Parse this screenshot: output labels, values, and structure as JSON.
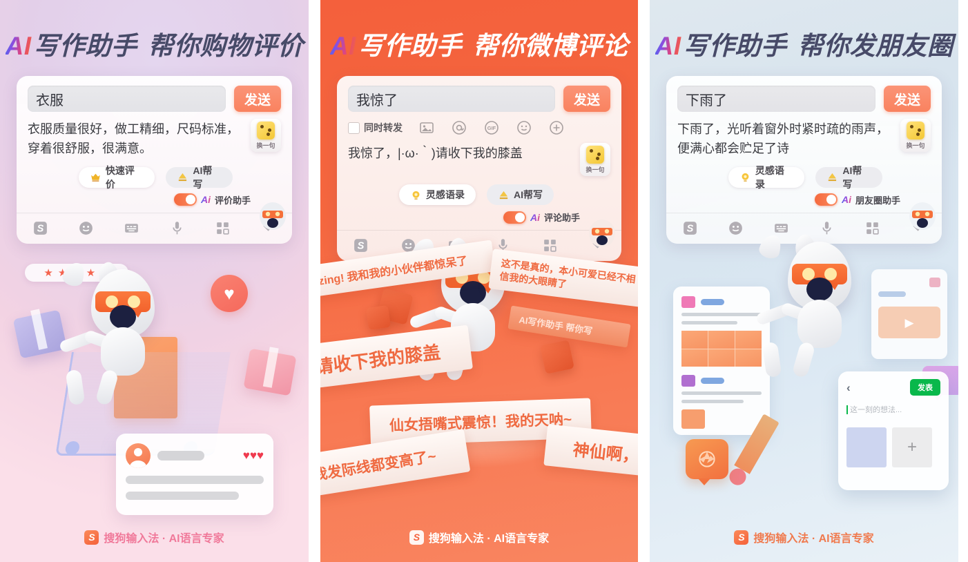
{
  "panels": [
    {
      "id": "shopping-review",
      "headline": {
        "ai": "AI",
        "main": "写作助手",
        "sub": "帮你购物评价"
      },
      "card": {
        "input_value": "衣服",
        "send_label": "发送",
        "generated_text": "衣服质量很好，做工精细，尺码标准，穿着很舒服，很满意。",
        "dice_label": "换一句",
        "chips": [
          {
            "icon": "crown-icon",
            "label": "快速评价"
          },
          {
            "icon": "pen-icon",
            "label": "AI帮写"
          }
        ],
        "assistant": {
          "ai": "Ai",
          "label": "评价助手",
          "toggle_on": true
        },
        "keyboard_icons": [
          "sogou-logo-icon",
          "emoji-icon",
          "keyboard-icon",
          "mic-icon",
          "apps-grid-icon",
          "chevron-down-icon"
        ]
      },
      "illustration": {
        "stars": "★★★★★",
        "review_card": {
          "hearts": "♥♥♥"
        }
      },
      "footer": {
        "logo": "S",
        "text": "搜狗输入法 · AI语言专家"
      }
    },
    {
      "id": "weibo-comment",
      "headline": {
        "ai": "AI",
        "main": "写作助手",
        "sub": "帮你微博评论"
      },
      "card": {
        "input_value": "我惊了",
        "send_label": "发送",
        "repost_checkbox_label": "同时转发",
        "compose_icons": [
          "image-icon",
          "at-icon",
          "gif-icon",
          "smiley-icon",
          "plus-icon"
        ],
        "generated_text": "我惊了，|·ω·｀)请收下我的膝盖",
        "dice_label": "换一句",
        "chips": [
          {
            "icon": "lightbulb-icon",
            "label": "灵感语录"
          },
          {
            "icon": "pen-icon",
            "label": "AI帮写"
          }
        ],
        "assistant": {
          "ai": "Ai",
          "label": "评论助手",
          "toggle_on": true
        },
        "keyboard_icons": [
          "sogou-logo-icon",
          "emoji-icon",
          "keyboard-icon",
          "mic-icon",
          "apps-grid-icon",
          "chevron-down-icon"
        ]
      },
      "illustration": {
        "ribbons": [
          "zing! 我和我的小伙伴都惊呆了",
          "这不是真的，本小可爱已经不相信我的大眼睛了",
          "请收下我的膝盖",
          "仙女捂嘴式震惊！我的天呐~",
          "我发际线都变高了~",
          "神仙啊，",
          "AI写作助手 帮你写"
        ]
      },
      "footer": {
        "logo": "S",
        "text": "搜狗输入法 · AI语言专家"
      }
    },
    {
      "id": "moments-post",
      "headline": {
        "ai": "AI",
        "main": "写作助手",
        "sub": "帮你发朋友圈"
      },
      "card": {
        "input_value": "下雨了",
        "send_label": "发送",
        "generated_text": "下雨了，光听着窗外时紧时疏的雨声，便满心都会贮足了诗",
        "dice_label": "换一句",
        "chips": [
          {
            "icon": "lightbulb-icon",
            "label": "灵感语录"
          },
          {
            "icon": "pen-icon",
            "label": "AI帮写"
          }
        ],
        "assistant": {
          "ai": "Ai",
          "label": "朋友圈助手",
          "toggle_on": true
        },
        "keyboard_icons": [
          "sogou-logo-icon",
          "emoji-icon",
          "keyboard-icon",
          "mic-icon",
          "apps-grid-icon",
          "chevron-down-icon"
        ]
      },
      "illustration": {
        "moments": {
          "back_icon": "chevron-left-icon",
          "post_label": "发表",
          "placeholder": "这一刻的想法...",
          "add_icon": "plus-icon"
        }
      },
      "footer": {
        "logo": "S",
        "text": "搜狗输入法 · AI语言专家"
      }
    }
  ]
}
